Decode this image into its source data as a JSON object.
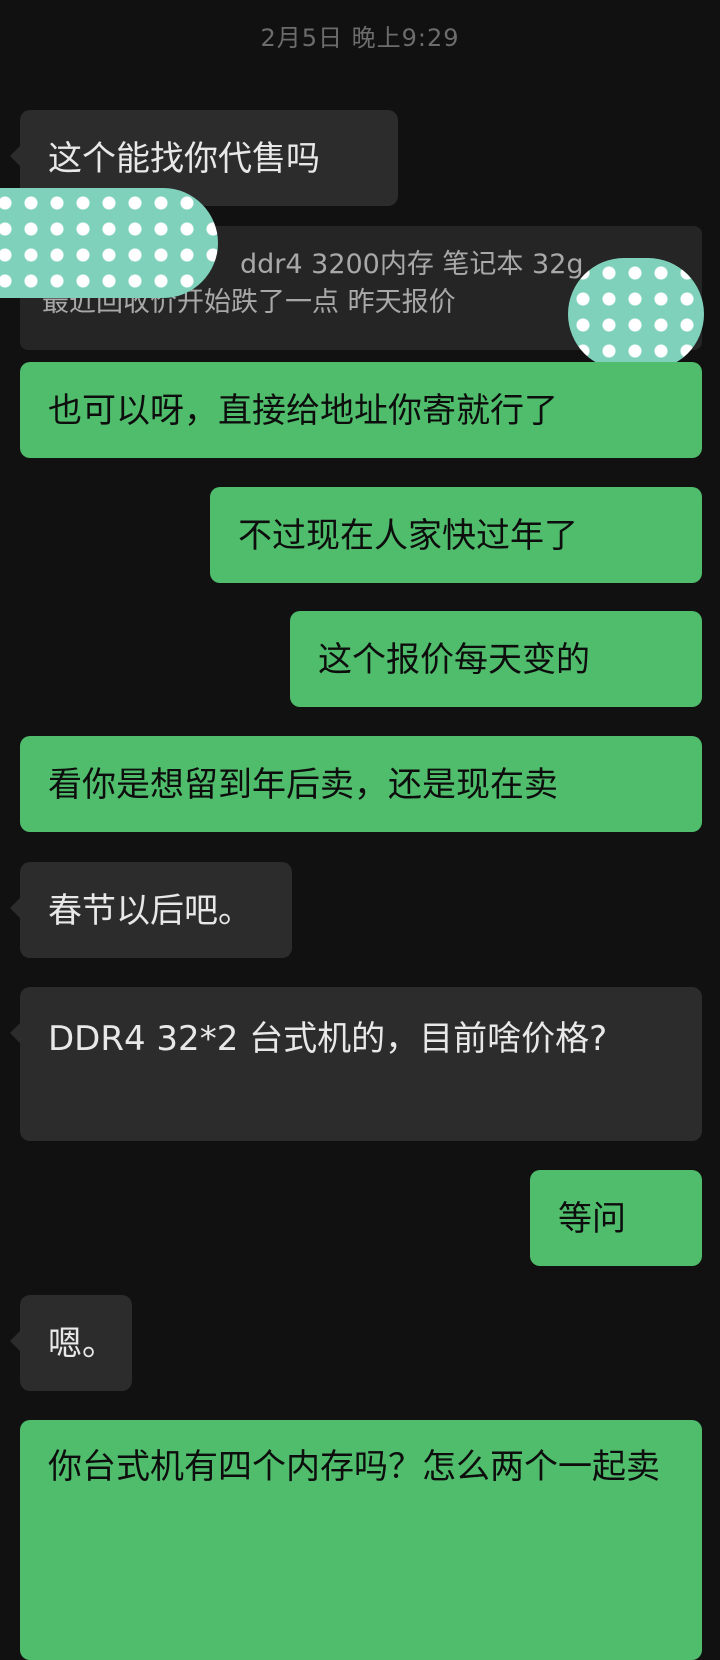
{
  "timestamp": "2月5日 晚上9:29",
  "quote": {
    "line1": "ddr4 3200内存 笔记本 32g",
    "line2": "最近回收价开始跌了一点 昨天报价"
  },
  "messages": [
    {
      "side": "in",
      "text": "这个能找你代售吗"
    },
    {
      "side": "out",
      "text": "也可以呀，直接给地址你寄就行了"
    },
    {
      "side": "out",
      "text": "不过现在人家快过年了"
    },
    {
      "side": "out",
      "text": "这个报价每天变的"
    },
    {
      "side": "out",
      "text": "看你是想留到年后卖，还是现在卖"
    },
    {
      "side": "in",
      "text": "春节以后吧。"
    },
    {
      "side": "in",
      "text": "DDR4 32*2 台式机的，目前啥价格?"
    },
    {
      "side": "out",
      "text": "等问"
    },
    {
      "side": "in",
      "text": "嗯。"
    },
    {
      "side": "out",
      "text": "你台式机有四个内存吗？怎么两个一起卖"
    }
  ],
  "colors": {
    "background": "#111111",
    "incoming_bubble": "#2c2c2c",
    "outgoing_bubble": "#4fbd6b",
    "redaction_sticker": "#7fd1bb"
  }
}
